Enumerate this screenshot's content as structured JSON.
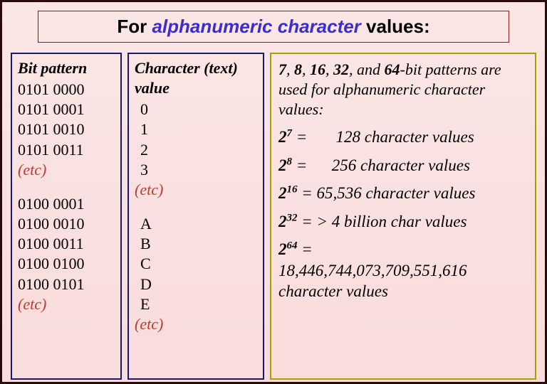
{
  "title": {
    "pre": "For ",
    "emph": "alphanumeric character",
    "post": " values:"
  },
  "col1": {
    "header": "Bit pattern",
    "group1": [
      "0101 0000",
      "0101 0001",
      "0101 0010",
      "0101 0011"
    ],
    "etc1": "(etc)",
    "group2": [
      "0100 0001",
      "0100 0010",
      "0100 0011",
      "0100 0100",
      "0100 0101"
    ],
    "etc2": "(etc)"
  },
  "col2": {
    "header": "Character (text) value",
    "group1": [
      "0",
      "1",
      "2",
      "3"
    ],
    "etc1": "(etc)",
    "group2": [
      "A",
      "B",
      "C",
      "D",
      "E"
    ],
    "etc2": "(etc)"
  },
  "col3": {
    "intro": {
      "bits": [
        "7",
        "8",
        "16",
        "32",
        "64"
      ],
      "tail": "-bit patterns are used for alphanumeric character values:"
    },
    "rows": [
      {
        "base": "2",
        "exp": "7",
        "eq": " =",
        "val": "128 character values",
        "pad": true
      },
      {
        "base": "2",
        "exp": "8",
        "eq": " =",
        "val": "256 character values",
        "pad": true
      },
      {
        "base": "2",
        "exp": "16",
        "eq": " =",
        "val": "65,536  character values",
        "pad": false
      },
      {
        "base": "2",
        "exp": "32",
        "eq": " =",
        "val": "> 4 billion char values",
        "pad": false
      }
    ],
    "last": {
      "base": "2",
      "exp": "64",
      "eq": " =",
      "val": "18,446,744,073,709,551,616 character values"
    }
  }
}
